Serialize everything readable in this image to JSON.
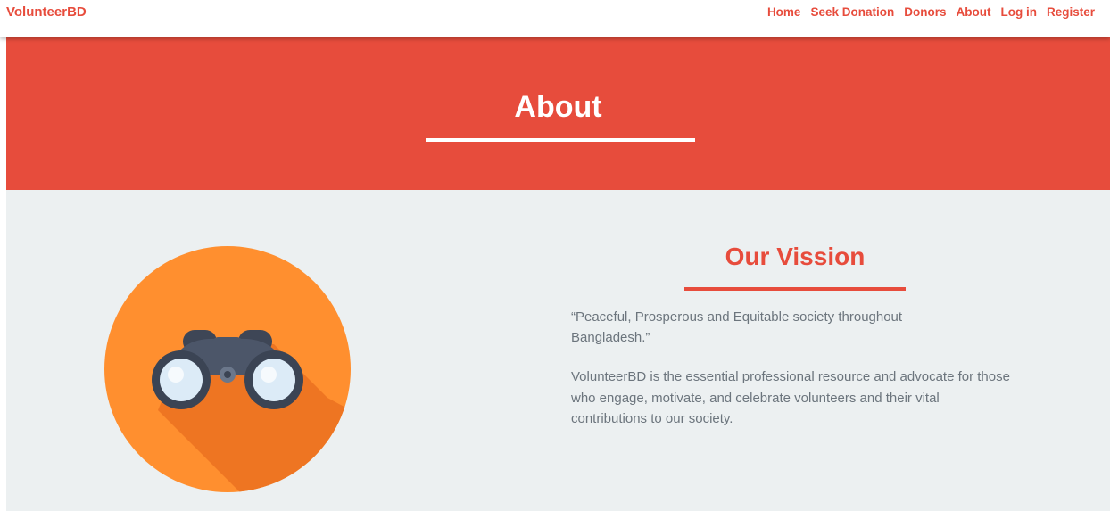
{
  "navbar": {
    "brand": "VolunteerBD",
    "links": [
      {
        "label": "Home"
      },
      {
        "label": "Seek Donation"
      },
      {
        "label": "Donors"
      },
      {
        "label": "About"
      },
      {
        "label": "Log in"
      },
      {
        "label": "Register"
      }
    ]
  },
  "hero": {
    "title": "About"
  },
  "vision": {
    "title": "Our Vission",
    "quote": "“Peaceful, Prosperous and Equitable society throughout Bangladesh.”",
    "body": "VolunteerBD is the essential professional resource and advocate for those who engage, motivate, and celebrate volunteers and their vital contributions to our society.",
    "icon": "binoculars-icon"
  },
  "colors": {
    "accent": "#e74c3c",
    "background": "#ecf0f1",
    "circle": "#ff8f2f",
    "circle_shadow": "#ee7522",
    "binocular_body": "#4c5669",
    "lens": "#dcebf7"
  }
}
